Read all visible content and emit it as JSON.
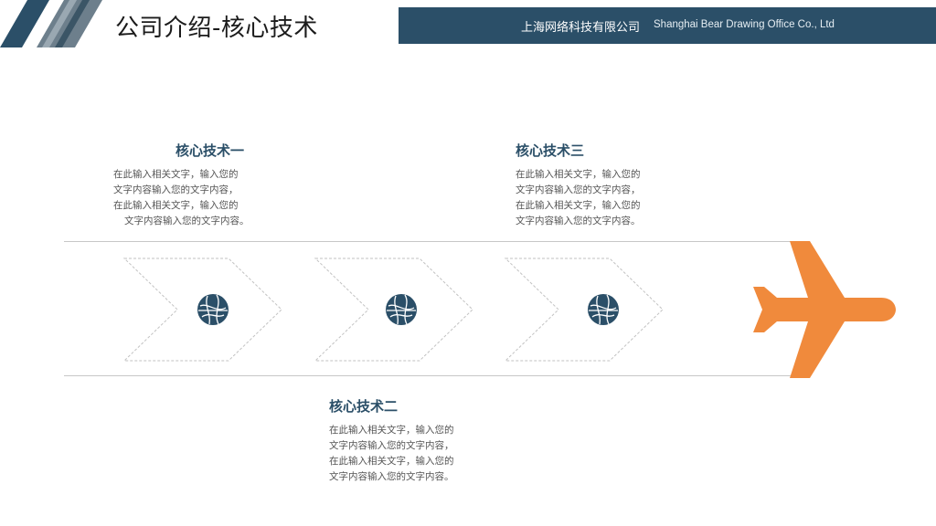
{
  "header": {
    "title": "公司介绍-核心技术",
    "company_cn": "上海网络科技有限公司",
    "company_en": "Shanghai Bear Drawing Office Co., Ltd",
    "bar_color": "#2b4f68"
  },
  "blocks": [
    {
      "title": "核心技术一",
      "lines": [
        "在此输入相关文字，输入您的",
        "文字内容输入您的文字内容，",
        "在此输入相关文字，输入您的",
        "文字内容输入您的文字内容。"
      ]
    },
    {
      "title": "核心技术二",
      "lines": [
        "在此输入相关文字，输入您的",
        "文字内容输入您的文字内容，",
        "在此输入相关文字，输入您的",
        "文字内容输入您的文字内容。"
      ]
    },
    {
      "title": "核心技术三",
      "lines": [
        "在此输入相关文字，输入您的",
        "文字内容输入您的文字内容，",
        "在此输入相关文字，输入您的",
        "文字内容输入您的文字内容。"
      ]
    }
  ],
  "icons": {
    "step_icon": "globe-icon",
    "end_icon": "airplane-icon",
    "accent_color": "#f08a3c"
  }
}
